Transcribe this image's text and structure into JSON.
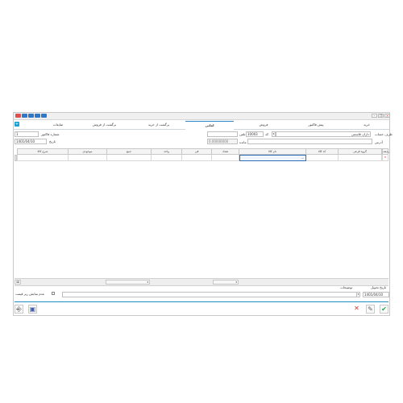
{
  "tabs": [
    "خرید",
    "پیش فاکتور",
    "فروش",
    "امانی",
    "برگشت از خرید",
    "برگشت از فروش",
    "ضایعات"
  ],
  "active_tab": "امانی",
  "header": {
    "party_label": "طرف حساب",
    "party_value": "داران قاسمی",
    "code_label": "کد",
    "code_value": "10003",
    "phone_label": "تلفن",
    "address_label": "آدرس",
    "balance_label": "مانده",
    "balance_value": "0.00000000",
    "invoice_no_label": "شماره فاکتور",
    "invoice_no_value": "1",
    "date_label": "تاریخ",
    "date_value": "1401/04/10"
  },
  "grid": {
    "columns": [
      "ردیف",
      "گروه فرعی",
      "کد کالا",
      "نام کالا",
      "تعداد",
      "فی",
      "واحد",
      "جمع",
      "موجودی",
      "شرح کالا"
    ],
    "row_name_cell": "..."
  },
  "footer": {
    "delivery_date_label": "تاریخ تحویل",
    "delivery_date_value": "1401/04/10",
    "notes_label": "توضیحات",
    "hide_price_label": "عدم نمایش ریز قیمت"
  },
  "icons": [
    "plus-icon",
    "delete-row-icon",
    "close-x-icon",
    "edit-icon",
    "confirm-check-icon",
    "exit-door-icon",
    "save-disk-icon"
  ],
  "colors": {
    "accent": "#1e8fc6",
    "delete": "#d9342b",
    "confirm": "#23a54a"
  }
}
